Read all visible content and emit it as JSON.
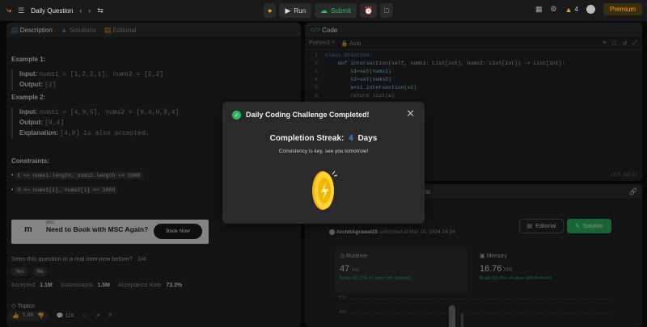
{
  "topbar": {
    "problem_list_label": "Daily Question",
    "run_label": "Run",
    "submit_label": "Submit",
    "streak_count": "4",
    "premium_label": "Premium"
  },
  "left_panel": {
    "tabs": [
      "Description",
      "Solutions",
      "Editorial"
    ],
    "example1_title": "Example 1:",
    "example1_input_label": "Input:",
    "example1_input": "nums1 = [1,2,2,1], nums2 = [2,2]",
    "example1_output_label": "Output:",
    "example1_output": "[2]",
    "example2_title": "Example 2:",
    "example2_input_label": "Input:",
    "example2_input": "nums1 = [4,9,5], nums2 = [9,4,9,8,4]",
    "example2_output_label": "Output:",
    "example2_output": "[9,4]",
    "example2_expl_label": "Explanation:",
    "example2_expl": "[4,9] is also accepted.",
    "constraints_title": "Constraints:",
    "constraint1": "1 <= nums1.length, nums2.length <= 1000",
    "constraint2": "0 <= nums1[i], nums2[i] <= 1000",
    "ad_sponsor": "MSC",
    "ad_title": "Need to Book with MSC Again?",
    "ad_button": "Book Now",
    "interview_q": "Seen this question in a real interview before?",
    "interview_count": "1/4",
    "yes": "Yes",
    "no": "No",
    "accepted_label": "Accepted",
    "accepted_value": "1.1M",
    "submissions_label": "Submissions",
    "submissions_value": "1.5M",
    "rate_label": "Acceptance Rate",
    "rate_value": "73.3%",
    "topics_label": "Topics",
    "likes": "5.8K",
    "comments": "116"
  },
  "code_panel": {
    "tab": "Code",
    "language": "Python3",
    "auto": "Auto",
    "lines": [
      "class Solution:",
      "    def intersection(self, nums1: List[int], nums2: List[int]) -> List[int]:",
      "        s1=set(nums1)",
      "        s2=set(nums2)",
      "        a=s1.intersection(s2)",
      "        return list(a)"
    ],
    "line_numbers": [
      "1",
      "2",
      "3",
      "4",
      "5",
      "6"
    ],
    "cursor": "Ln 6, Col 22"
  },
  "result_panel": {
    "tab_suffix": "tions",
    "author": "ArchitAgrawal25",
    "submitted_at": "submitted at Mar 10, 2024 14:34",
    "editorial_btn": "Editorial",
    "solution_btn": "Solution",
    "runtime_label": "Runtime",
    "runtime_value": "47",
    "runtime_unit": "ms",
    "runtime_beats": "Beats 48.21% of users with Python3",
    "memory_label": "Memory",
    "memory_value": "16.76",
    "memory_unit": "MB",
    "memory_beats": "Beats 53.45% of users with Python3",
    "axis1": "6%",
    "axis2": "4%"
  },
  "modal": {
    "title": "Daily Coding Challenge Completed!",
    "streak_label": "Completion Streak:",
    "streak_value": "4",
    "streak_unit": "Days",
    "message": "Consistency is key, see you tomorrow!"
  },
  "colors": {
    "accent_orange": "#ffa116",
    "green": "#2cbb5d",
    "blue": "#3c8dde"
  }
}
